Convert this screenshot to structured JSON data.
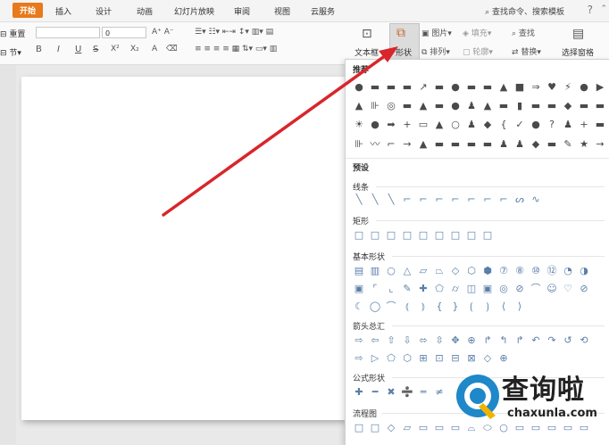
{
  "menubar": {
    "tabs": [
      "开始",
      "插入",
      "设计",
      "动画",
      "幻灯片放映",
      "审阅",
      "视图",
      "云服务"
    ],
    "search_text": "查找命令、搜索模板",
    "help": "?"
  },
  "ribbon": {
    "reset_label": "重置",
    "section_label": "节",
    "font_size": "0",
    "textbox_label": "文本框",
    "shape_label": "形状",
    "picture_label": "图片",
    "fill_label": "填充",
    "arrange_label": "排列",
    "outline_label": "轮廓",
    "find_label": "查找",
    "replace_label": "替换",
    "select_pane_label": "选择窗格",
    "format_glyphs": [
      "B",
      "I",
      "U",
      "S",
      "X²",
      "X₂",
      "A"
    ]
  },
  "panel": {
    "recommended_title": "推荐",
    "preset_title": "预设",
    "categories": {
      "lines": "线条",
      "rectangles": "矩形",
      "basic": "基本形状",
      "arrows": "箭头总汇",
      "equation": "公式形状",
      "flowchart": "流程图"
    },
    "recommended_rows": [
      "●▬▬▬↗▬●▬▬▲■⇒♥⚡●▶",
      "▲⊪◎▬▲▬●♟▲▬▮▬▬◆▬▬",
      "☀●➡+▭▲○♟◆{✓●?♟+▬",
      "⊪〰⌐→▲▬▬▬▬♟♟◆▬✎★→"
    ],
    "lines_row": "╲╲╲⌐⌐⌐⌐⌐⌐⌐ᔕ∿",
    "rect_row": "□□□□□□□□□",
    "basic_rows": [
      "▤▥○△▱⏢◇⬡⬢⑦⑧⑩⑫◔◑",
      "▣⌜⌞✎✚⬠⌭◫▣◎⊘⌒☺♡⊘",
      "☾◯⌒⦅⦆{}⟮⟯⟨⟩"
    ],
    "arrow_rows": [
      "⇨⇦⇧⇩⬄⇳✥⊕↱↰↱↶↷↺⟲",
      "⇨▷⬠⬡⊞⊡⊟⊠◇⊕"
    ],
    "equation_row": "✚━✖➗═≠",
    "flow_row": "□□◇▱▭▭▭⌓⬭○▭▭▭▭▭"
  },
  "watermark": {
    "name": "查询啦",
    "domain": "chaxunla.com"
  },
  "colors": {
    "accent": "#e8791c",
    "arrow": "#d8262b",
    "shape_dark": "#4a4a4a",
    "shape_outline": "#5a7fa8"
  }
}
